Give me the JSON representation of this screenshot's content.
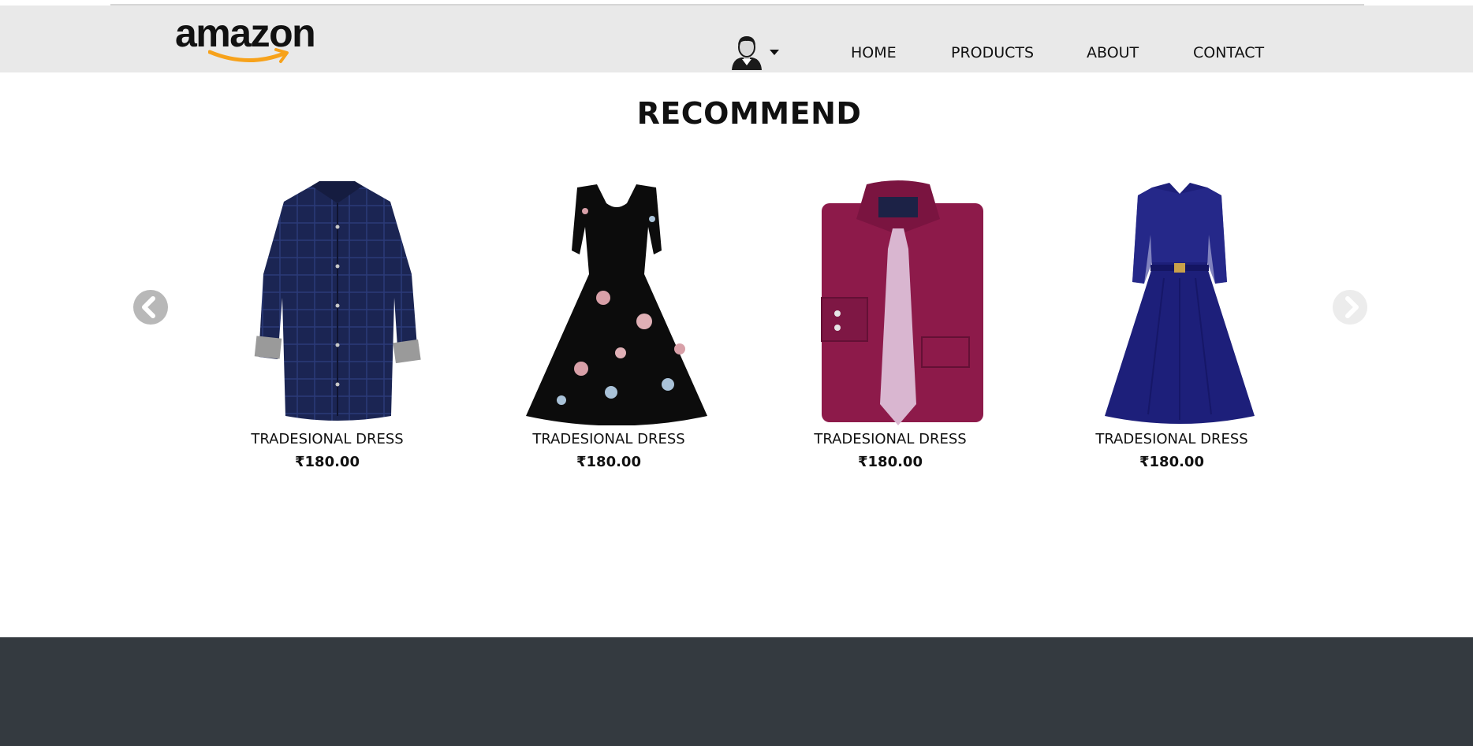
{
  "header": {
    "logo_text": "amazon",
    "user_icon": "user-avatar-icon",
    "nav": [
      "HOME",
      "PRODUCTS",
      "ABOUT",
      "CONTACT"
    ]
  },
  "section_title": "RECOMMEND",
  "carousel": {
    "prev_icon": "chevron-left-icon",
    "next_icon": "chevron-right-icon",
    "products": [
      {
        "name": "TRADESIONAL DRESS",
        "price": "₹180.00",
        "image": "navy-check-shirt"
      },
      {
        "name": "TRADESIONAL DRESS",
        "price": "₹180.00",
        "image": "black-floral-dress"
      },
      {
        "name": "TRADESIONAL DRESS",
        "price": "₹180.00",
        "image": "maroon-shirt-with-tie"
      },
      {
        "name": "TRADESIONAL DRESS",
        "price": "₹180.00",
        "image": "navy-lace-dress"
      }
    ]
  },
  "colors": {
    "header_bg": "#e9e9e9",
    "footer_bg": "#343a40",
    "logo_smile": "#f7a21b"
  }
}
